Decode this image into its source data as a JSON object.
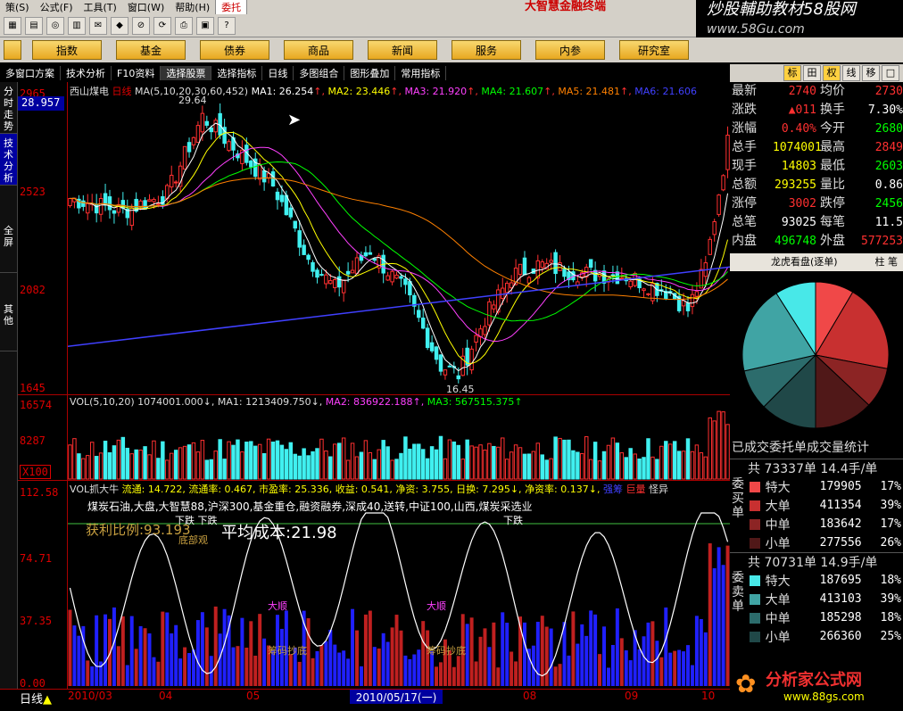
{
  "menu": [
    "策(S)",
    "公式(F)",
    "工具(T)",
    "窗口(W)",
    "帮助(H)",
    "委托"
  ],
  "brand": "大智慧金融终端",
  "watermark": {
    "line1": "炒股輔助教材58股网",
    "line2": "www.58Gu.com"
  },
  "nav": [
    "指数",
    "基金",
    "债券",
    "商品",
    "新闻",
    "服务",
    "内参",
    "研究室"
  ],
  "funcbar": [
    "多窗口方案",
    "技术分析",
    "F10资料",
    "选择股票",
    "选择指标",
    "日线",
    "多图组合",
    "图形叠加",
    "常用指标"
  ],
  "sidebar": [
    "分时走势",
    "技术分析",
    "全屏",
    "其他"
  ],
  "main": {
    "name": "西山煤电",
    "period_tag": "日线",
    "ma_spec": "MA(5,10,20,30,60,452)",
    "ma_labels": [
      "MA1: 26.254",
      "MA2: 23.446",
      "MA3: 21.920",
      "MA4: 21.607",
      "MA5: 21.481",
      "MA6: 21.606"
    ],
    "ma_colors": [
      "#ffffff",
      "#ffff00",
      "#ff40ff",
      "#00ff00",
      "#ff8000",
      "#4040ff"
    ],
    "current": "28.957",
    "yticks": [
      "2965",
      "2523",
      "2082",
      "1645"
    ],
    "high_label": "29.64",
    "low_label": "16.45"
  },
  "vol": {
    "header": "VOL(5,10,20)  1074001.000↓,  MA1: 1213409.750↓,",
    "ma2": "MA2: 836922.188↑,",
    "ma3": "MA3: 567515.375↑",
    "yticks": [
      "16574",
      "8287",
      "X100"
    ]
  },
  "ind": {
    "header_left": "VOL抓大牛",
    "header_items": [
      "流通: 14.722,",
      "流通率: 0.467,",
      "市盈率: 25.336,",
      "收益: 0.541,",
      "净资: 3.755,",
      "日换: 7.295↓,",
      "净资率: 0.137↓,"
    ],
    "header_tail": [
      "强筹",
      "巨量",
      "怪异"
    ],
    "sectors": "煤炭石油,大盘,大智慧88,沪深300,基金重仓,融资融券,深成40,送转,中证100,山西,煤炭采选业",
    "profit": "获利比例:93.193",
    "avgcost": "平均成本:21.98",
    "labels": {
      "down1": "下跌 下跌",
      "down2": "下跌",
      "bottom": "底部观",
      "dashun": "大顺",
      "cutbottom": "筹码抄底"
    },
    "yticks": [
      "112.58",
      "74.71",
      "37.35",
      "0.00"
    ]
  },
  "bottom": {
    "period": "日线",
    "dates": [
      "2010/03",
      "04",
      "05",
      "07",
      "08",
      "09",
      "10"
    ],
    "current_date": "2010/05/17(一)"
  },
  "rtabs": [
    "标",
    "田",
    "权",
    "线",
    "移",
    "□"
  ],
  "quote": [
    {
      "l1": "最新",
      "v1": "2740",
      "c1": "#ff3030",
      "l2": "均价",
      "v2": "2730",
      "c2": "#ff3030"
    },
    {
      "l1": "涨跌",
      "v1": "▲011",
      "c1": "#ff3030",
      "l2": "换手",
      "v2": "7.30%",
      "c2": "#ffffff"
    },
    {
      "l1": "涨幅",
      "v1": "0.40%",
      "c1": "#ff3030",
      "l2": "今开",
      "v2": "2680",
      "c2": "#00ff00"
    },
    {
      "l1": "总手",
      "v1": "1074001",
      "c1": "#ffff00",
      "l2": "最高",
      "v2": "2849",
      "c2": "#ff3030"
    },
    {
      "l1": "现手",
      "v1": "14803",
      "c1": "#ffff00",
      "l2": "最低",
      "v2": "2603",
      "c2": "#00ff00"
    },
    {
      "l1": "总额",
      "v1": "293255",
      "c1": "#ffff00",
      "l2": "量比",
      "v2": "0.86",
      "c2": "#ffffff"
    },
    {
      "l1": "涨停",
      "v1": "3002",
      "c1": "#ff3030",
      "l2": "跌停",
      "v2": "2456",
      "c2": "#00ff00"
    },
    {
      "l1": "总笔",
      "v1": "93025",
      "c1": "#ffffff",
      "l2": "每笔",
      "v2": "11.5",
      "c2": "#ffffff"
    },
    {
      "l1": "内盘",
      "v1": "496748",
      "c1": "#00ff00",
      "l2": "外盘",
      "v2": "577253",
      "c2": "#ff3030"
    }
  ],
  "lh": {
    "title": "龙虎看盘(逐单)",
    "t1": "柱",
    "t2": "笔"
  },
  "pie": [
    {
      "label": "特大买",
      "value": 17,
      "color": "#f04848"
    },
    {
      "label": "大买",
      "value": 39,
      "color": "#c83030"
    },
    {
      "label": "中买",
      "value": 18,
      "color": "#8c2424"
    },
    {
      "label": "小买",
      "value": 26,
      "color": "#501818"
    },
    {
      "label": "小卖",
      "value": 25,
      "color": "#204848"
    },
    {
      "label": "中卖",
      "value": 18,
      "color": "#2c6c6c"
    },
    {
      "label": "大卖",
      "value": 39,
      "color": "#40a4a4"
    },
    {
      "label": "特大卖",
      "value": 18,
      "color": "#48e8e8"
    }
  ],
  "stats_title": "已成交委托单成交量统计",
  "buy": {
    "head": "共 73337单 14.4手/单",
    "side": "委买单",
    "rows": [
      {
        "name": "特大",
        "vol": "179905",
        "pct": "17%",
        "color": "#f04848"
      },
      {
        "name": "大单",
        "vol": "411354",
        "pct": "39%",
        "color": "#c83030"
      },
      {
        "name": "中单",
        "vol": "183642",
        "pct": "17%",
        "color": "#8c2424"
      },
      {
        "name": "小单",
        "vol": "277556",
        "pct": "26%",
        "color": "#501818"
      }
    ]
  },
  "sell": {
    "head": "共 70731单 14.9手/单",
    "side": "委卖单",
    "rows": [
      {
        "name": "特大",
        "vol": "187695",
        "pct": "18%",
        "color": "#48e8e8"
      },
      {
        "name": "大单",
        "vol": "413103",
        "pct": "39%",
        "color": "#40a4a4"
      },
      {
        "name": "中单",
        "vol": "185298",
        "pct": "18%",
        "color": "#2c6c6c"
      },
      {
        "name": "小单",
        "vol": "266360",
        "pct": "25%",
        "color": "#204848"
      }
    ]
  },
  "footlogo": {
    "t1": "分析家公式网",
    "t2": "www.88gs.com"
  }
}
